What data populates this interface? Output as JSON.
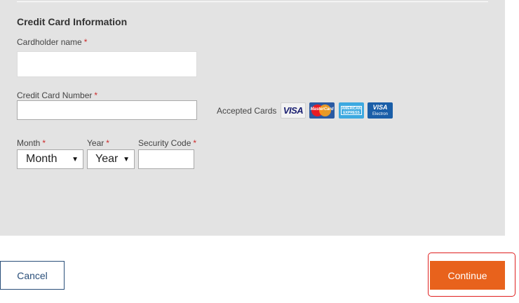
{
  "form": {
    "section_title": "Credit Card Information",
    "required_mark": "*",
    "cardholder_label": "Cardholder name",
    "cardholder_value": "",
    "card_number_label": "Credit Card Number",
    "card_number_value": "",
    "month_label": "Month",
    "month_selected": "Month",
    "year_label": "Year",
    "year_selected": "Year",
    "security_label": "Security Code",
    "security_value": "",
    "accepted_label": "Accepted Cards"
  },
  "cards": [
    {
      "name": "visa",
      "text": "VISA"
    },
    {
      "name": "mastercard",
      "text": "MasterCard"
    },
    {
      "name": "american-express",
      "text": "AMERICAN EXPRESS"
    },
    {
      "name": "visa-electron",
      "text": "VISA",
      "subtext": "Electron"
    }
  ],
  "actions": {
    "cancel_label": "Cancel",
    "continue_label": "Continue"
  },
  "colors": {
    "accent": "#e8621c",
    "panel": "#e3e3e3",
    "required": "#cc2a2a",
    "cancel_border": "#2a4f7a",
    "highlight": "#e02020"
  },
  "icons": [
    "chevron-down-icon",
    "visa-card-icon",
    "mastercard-icon",
    "amex-card-icon",
    "visa-electron-icon"
  ]
}
